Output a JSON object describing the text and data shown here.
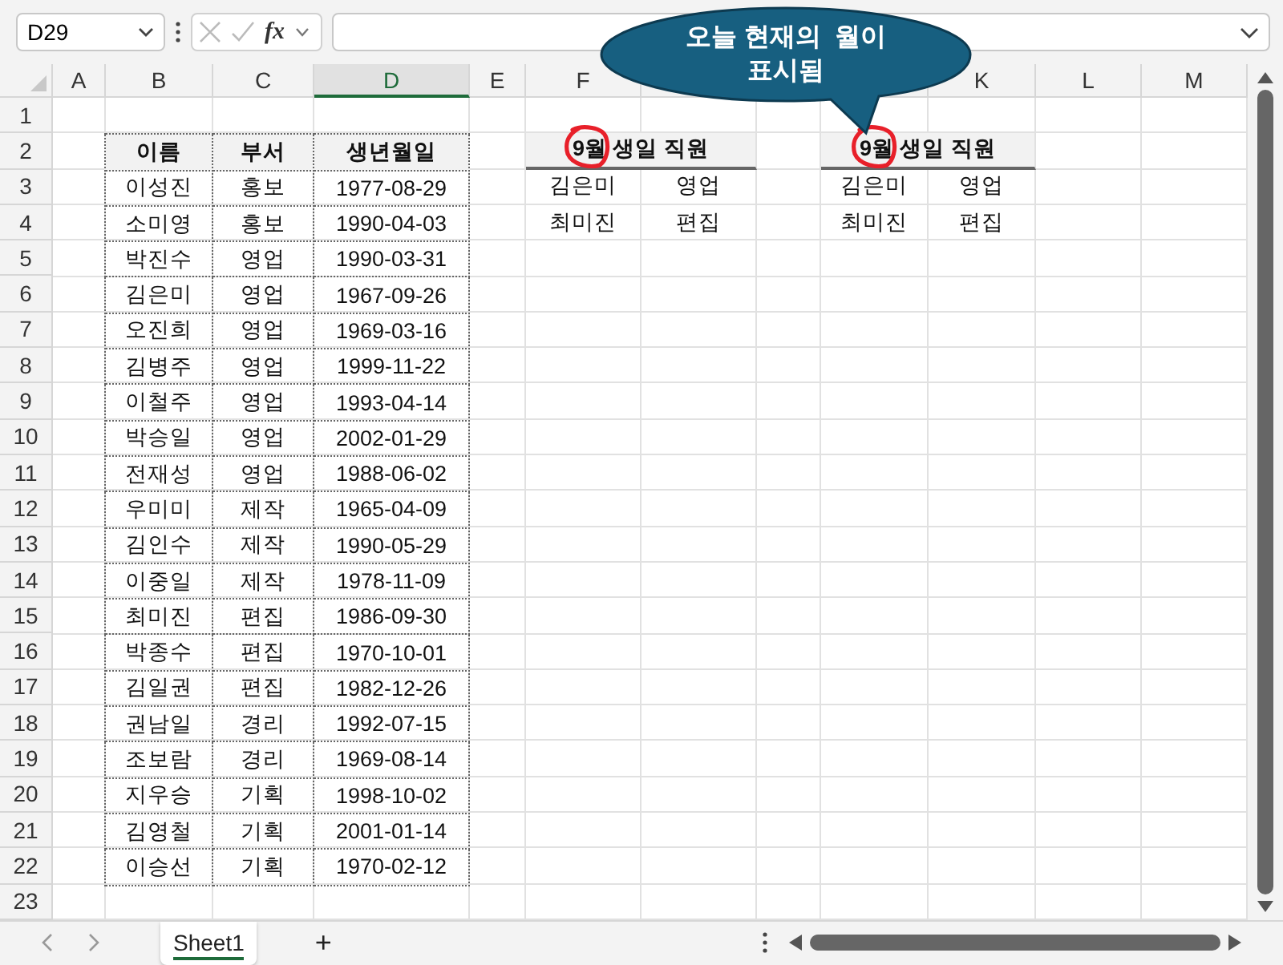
{
  "name_box": "D29",
  "function_label": "fx",
  "columns": [
    {
      "label": "A",
      "selected": false
    },
    {
      "label": "B",
      "selected": false
    },
    {
      "label": "C",
      "selected": false
    },
    {
      "label": "D",
      "selected": true
    },
    {
      "label": "E",
      "selected": false
    },
    {
      "label": "F",
      "selected": false
    },
    {
      "label": "K",
      "selected": false
    },
    {
      "label": "L",
      "selected": false
    },
    {
      "label": "M",
      "selected": false
    }
  ],
  "rows": [
    "1",
    "2",
    "3",
    "4",
    "5",
    "6",
    "7",
    "8",
    "9",
    "10",
    "11",
    "12",
    "13",
    "14",
    "15",
    "16",
    "17",
    "18",
    "19",
    "20",
    "21",
    "22",
    "23"
  ],
  "employees": {
    "header": [
      "이름",
      "부서",
      "생년월일"
    ],
    "rows": [
      [
        "이성진",
        "홍보",
        "1977-08-29"
      ],
      [
        "소미영",
        "홍보",
        "1990-04-03"
      ],
      [
        "박진수",
        "영업",
        "1990-03-31"
      ],
      [
        "김은미",
        "영업",
        "1967-09-26"
      ],
      [
        "오진희",
        "영업",
        "1969-03-16"
      ],
      [
        "김병주",
        "영업",
        "1999-11-22"
      ],
      [
        "이철주",
        "영업",
        "1993-04-14"
      ],
      [
        "박승일",
        "영업",
        "2002-01-29"
      ],
      [
        "전재성",
        "영업",
        "1988-06-02"
      ],
      [
        "우미미",
        "제작",
        "1965-04-09"
      ],
      [
        "김인수",
        "제작",
        "1990-05-29"
      ],
      [
        "이중일",
        "제작",
        "1978-11-09"
      ],
      [
        "최미진",
        "편집",
        "1986-09-30"
      ],
      [
        "박종수",
        "편집",
        "1970-10-01"
      ],
      [
        "김일권",
        "편집",
        "1982-12-26"
      ],
      [
        "권남일",
        "경리",
        "1992-07-15"
      ],
      [
        "조보람",
        "경리",
        "1969-08-14"
      ],
      [
        "지우승",
        "기획",
        "1998-10-02"
      ],
      [
        "김영철",
        "기획",
        "2001-01-14"
      ],
      [
        "이승선",
        "기획",
        "1970-02-12"
      ]
    ]
  },
  "birthday_tables": [
    {
      "title": "9월 생일 직원",
      "rows": [
        [
          "김은미",
          "영업"
        ],
        [
          "최미진",
          "편집"
        ]
      ]
    },
    {
      "title": "9월 생일 직원",
      "rows": [
        [
          "김은미",
          "영업"
        ],
        [
          "최미진",
          "편집"
        ]
      ]
    }
  ],
  "callout": [
    "오늘 현재의  월이",
    "표시됨"
  ],
  "sheet_tabs": [
    {
      "label": "Sheet1",
      "selected": true
    }
  ],
  "add_sheet": "+"
}
